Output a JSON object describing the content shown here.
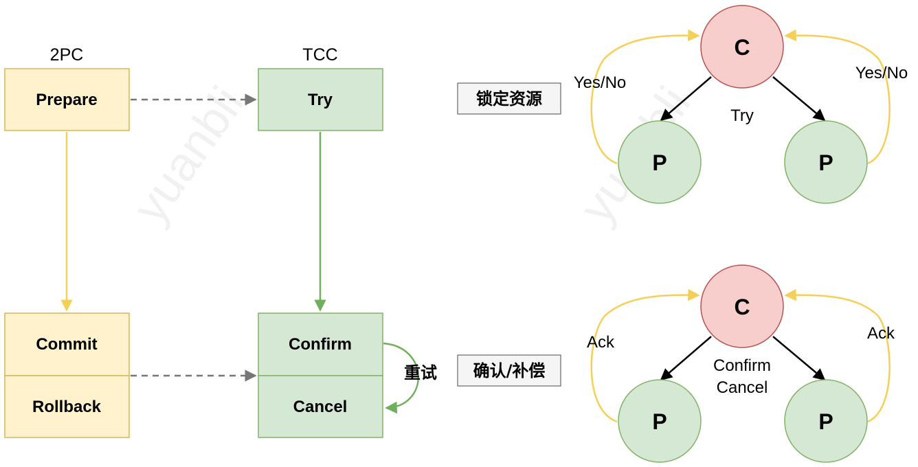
{
  "watermark": "yuanbli",
  "left": {
    "col_2pc_title": "2PC",
    "col_tcc_title": "TCC",
    "prepare": "Prepare",
    "commit": "Commit",
    "rollback": "Rollback",
    "try": "Try",
    "confirm": "Confirm",
    "cancel": "Cancel",
    "retry": "重试"
  },
  "tags": {
    "lock_resource": "锁定资源",
    "confirm_compensate": "确认/补偿"
  },
  "top_diagram": {
    "coordinator": "C",
    "participant_left": "P",
    "participant_right": "P",
    "edge_label": "Try",
    "vote_left": "Yes/No",
    "vote_right": "Yes/No"
  },
  "bottom_diagram": {
    "coordinator": "C",
    "participant_left": "P",
    "participant_right": "P",
    "edge_label_1": "Confirm",
    "edge_label_2": "Cancel",
    "ack_left": "Ack",
    "ack_right": "Ack"
  },
  "colors": {
    "yellow_fill": "#fff2cc",
    "yellow_stroke": "#d6b656",
    "green_fill": "#d5e8d4",
    "green_stroke": "#82b366",
    "red_fill": "#f8cecc",
    "red_stroke": "#b85450",
    "arrow_yellow": "#f5cf57",
    "arrow_green": "#6fae5a",
    "arrow_dashed": "#777777"
  }
}
